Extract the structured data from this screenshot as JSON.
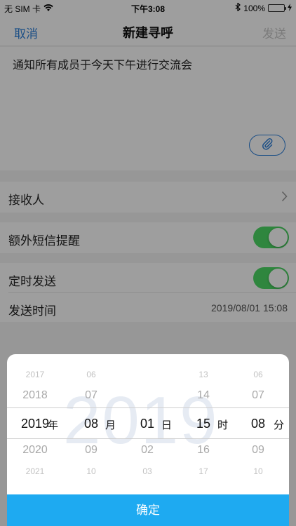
{
  "status_bar": {
    "carrier": "无 SIM 卡",
    "time": "下午3:08",
    "battery": "100%"
  },
  "nav": {
    "cancel": "取消",
    "title": "新建寻呼",
    "send": "发送"
  },
  "message": {
    "text": "通知所有成员于今天下午进行交流会"
  },
  "rows": {
    "recipients_label": "接收人",
    "sms_label": "额外短信提醒",
    "scheduled_label": "定时发送",
    "send_time_label": "发送时间",
    "send_time_value": "2019/08/01 15:08"
  },
  "toggles": {
    "sms_on": true,
    "scheduled_on": true
  },
  "picker": {
    "watermark": "2019",
    "year": {
      "items": [
        "2017",
        "2018",
        "2019",
        "2020",
        "2021"
      ],
      "unit": "年"
    },
    "month": {
      "items": [
        "06",
        "07",
        "08",
        "09",
        "10"
      ],
      "unit": "月"
    },
    "day": {
      "items": [
        "",
        "",
        "01",
        "02",
        "03"
      ],
      "unit": "日"
    },
    "hour": {
      "items": [
        "13",
        "14",
        "15",
        "16",
        "17"
      ],
      "unit": "时"
    },
    "minute": {
      "items": [
        "06",
        "07",
        "08",
        "09",
        "10"
      ],
      "unit": "分"
    },
    "confirm": "确定"
  },
  "colors": {
    "accent": "#2b7ed8",
    "toggle_on": "#4cd964",
    "confirm_bg": "#1eaaf1"
  }
}
